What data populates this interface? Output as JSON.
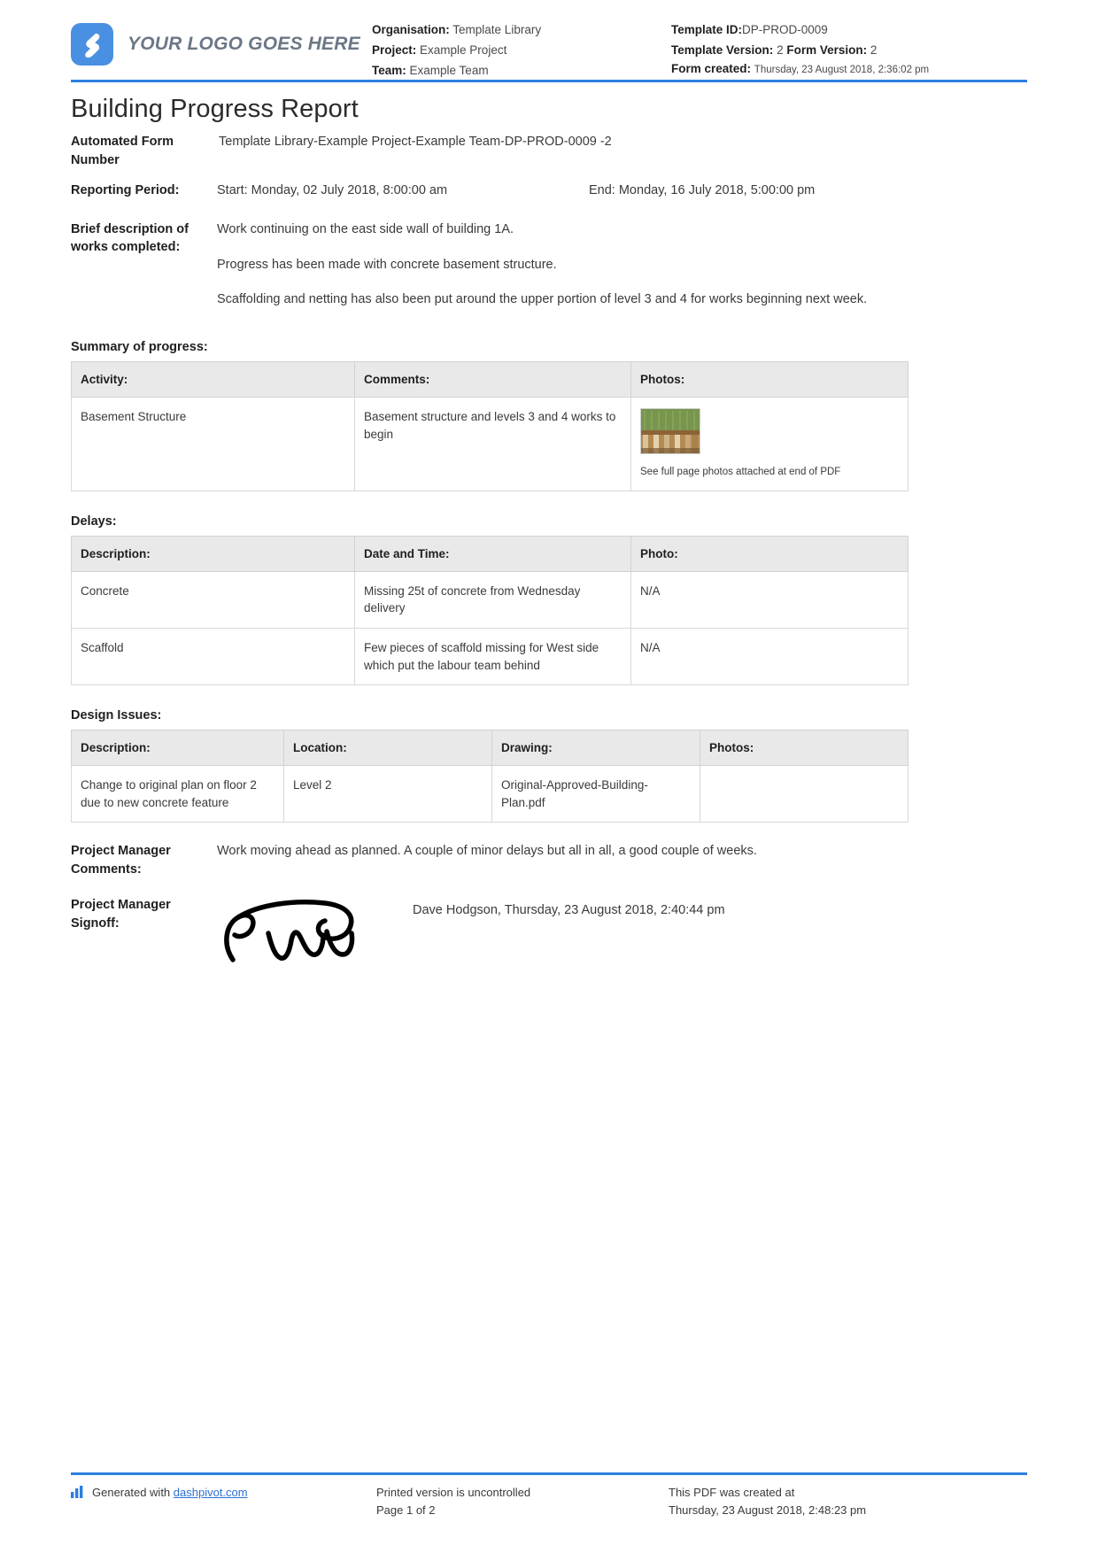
{
  "header": {
    "logo_text": "YOUR LOGO GOES HERE",
    "logo_icon": "dashpivot-logo-icon",
    "accent_color": "#2e7fe0",
    "logo_color": "#4a90e2",
    "left_meta": [
      {
        "label": "Organisation:",
        "value": "Template Library"
      },
      {
        "label": "Project:",
        "value": "Example Project"
      },
      {
        "label": "Team:",
        "value": "Example Team"
      }
    ],
    "right_meta": {
      "template_id_label": "Template ID:",
      "template_id_value": "DP-PROD-0009",
      "template_version_label": "Template Version:",
      "template_version_value": "2",
      "form_version_label": "Form Version:",
      "form_version_value": "2",
      "form_created_label": "Form created:",
      "form_created_value": "Thursday, 23 August 2018, 2:36:02 pm"
    }
  },
  "title": "Building Progress Report",
  "fields": {
    "automated_form_number_label": "Automated Form Number",
    "automated_form_number_value": "Template Library-Example Project-Example Team-DP-PROD-0009   -2",
    "reporting_period_label": "Reporting Period:",
    "reporting_period_start": "Start: Monday, 02 July 2018, 8:00:00 am",
    "reporting_period_end": "End: Monday, 16 July 2018, 5:00:00 pm",
    "brief_description_label": "Brief description of works completed:",
    "brief_description_paragraphs": [
      "Work continuing on the east side wall of building 1A.",
      "Progress has been made with concrete basement structure.",
      "Scaffolding and netting has also been put around the upper portion of level 3 and 4 for works beginning next week."
    ]
  },
  "summary_of_progress": {
    "heading": "Summary of progress:",
    "columns": [
      "Activity:",
      "Comments:",
      "Photos:"
    ],
    "rows": [
      {
        "activity": "Basement Structure",
        "comments": "Basement structure and levels 3 and 4 works to begin",
        "photo_caption": "See full page photos attached at end of PDF"
      }
    ]
  },
  "delays": {
    "heading": "Delays:",
    "columns": [
      "Description:",
      "Date and Time:",
      "Photo:"
    ],
    "rows": [
      {
        "description": "Concrete",
        "date_and_time": "Missing 25t of concrete from Wednesday delivery",
        "photo": "N/A"
      },
      {
        "description": "Scaffold",
        "date_and_time": "Few pieces of scaffold missing for West side which put the labour team behind",
        "photo": "N/A"
      }
    ]
  },
  "design_issues": {
    "heading": "Design Issues:",
    "columns": [
      "Description:",
      "Location:",
      "Drawing:",
      "Photos:"
    ],
    "rows": [
      {
        "description": "Change to original plan on floor 2 due to new concrete feature",
        "location": "Level 2",
        "drawing": "Original-Approved-Building-Plan.pdf",
        "photos": ""
      }
    ]
  },
  "project_manager": {
    "comments_label": "Project Manager Comments:",
    "comments_value": "Work moving ahead as planned. A couple of minor delays but all in all, a good couple of weeks.",
    "signoff_label": "Project Manager Signoff:",
    "signoff_meta": "Dave Hodgson, Thursday, 23 August 2018, 2:40:44 pm",
    "signature_alt": "handwritten-signature"
  },
  "footer": {
    "generated_prefix": "Generated with ",
    "generated_link": "dashpivot.com",
    "printed_notice": "Printed version is uncontrolled",
    "page_number": "Page 1 of 2",
    "created_notice": "This PDF was created at",
    "created_timestamp": "Thursday, 23 August 2018, 2:48:23 pm",
    "chart_icon": "bar-chart-icon"
  }
}
